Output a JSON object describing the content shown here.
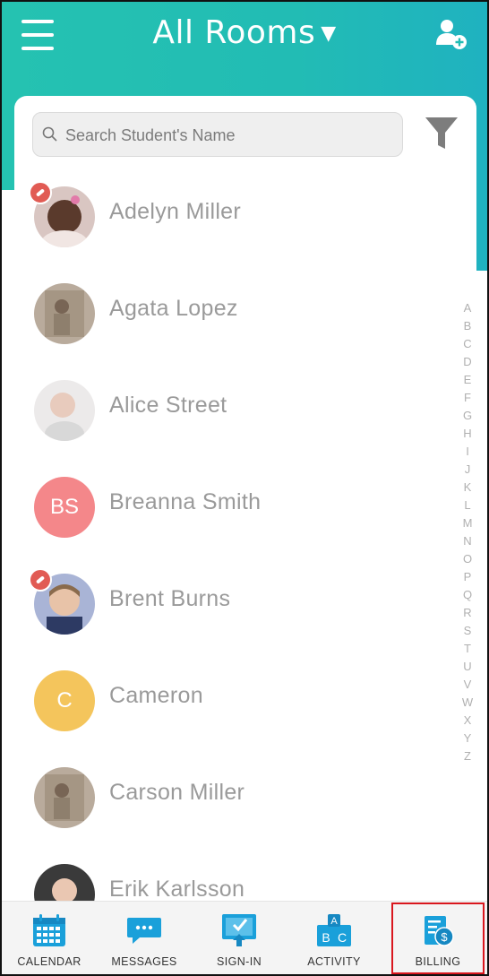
{
  "header": {
    "title": "All Rooms"
  },
  "search": {
    "placeholder": "Search Student's Name"
  },
  "colors": {
    "teal": "#25c2b1",
    "icon_blue": "#1aa0da",
    "highlight": "#d9171e"
  },
  "students": [
    {
      "name": "Adelyn Miller",
      "badge": true
    },
    {
      "name": "Agata Lopez",
      "badge": false
    },
    {
      "name": "Alice Street",
      "badge": false
    },
    {
      "name": "Breanna Smith",
      "initials": "BS",
      "avatar_color": "#f4878a"
    },
    {
      "name": "Brent Burns",
      "badge": true
    },
    {
      "name": "Cameron",
      "initials": "C",
      "avatar_color": "#f4c55c"
    },
    {
      "name": "Carson Miller",
      "badge": false
    },
    {
      "name": "Erik Karlsson",
      "badge": false
    }
  ],
  "alphabet": [
    "A",
    "B",
    "C",
    "D",
    "E",
    "F",
    "G",
    "H",
    "I",
    "J",
    "K",
    "L",
    "M",
    "N",
    "O",
    "P",
    "Q",
    "R",
    "S",
    "T",
    "U",
    "V",
    "W",
    "X",
    "Y",
    "Z"
  ],
  "nav": [
    {
      "label": "CALENDAR",
      "icon": "calendar-icon"
    },
    {
      "label": "MESSAGES",
      "icon": "chat-icon"
    },
    {
      "label": "SIGN-IN",
      "icon": "sign-in-icon"
    },
    {
      "label": "ACTIVITY",
      "icon": "abc-blocks-icon"
    },
    {
      "label": "BILLING",
      "icon": "billing-icon",
      "active": true
    }
  ]
}
